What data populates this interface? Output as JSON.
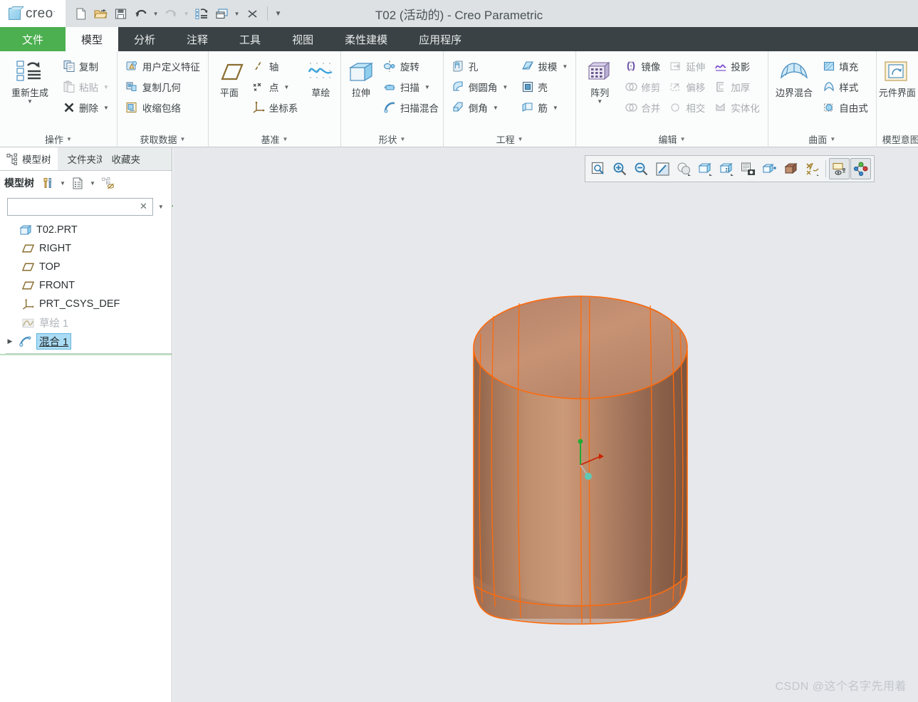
{
  "window": {
    "title": "T02 (活动的) - Creo Parametric",
    "brand": "creo"
  },
  "quick_access": {
    "items": [
      {
        "name": "new-file-button",
        "icon": "new-document-icon",
        "label": "新建"
      },
      {
        "name": "open-file-button",
        "icon": "open-folder-icon",
        "label": "打开"
      },
      {
        "name": "save-button",
        "icon": "floppy-disk-icon",
        "label": "保存"
      },
      {
        "name": "undo-button",
        "icon": "undo-arrow-icon",
        "label": "撤消"
      },
      {
        "name": "redo-button",
        "icon": "redo-arrow-icon",
        "label": "重做"
      },
      {
        "name": "regenerate-button",
        "icon": "regenerate-icon",
        "label": "重新生成"
      },
      {
        "name": "window-button",
        "icon": "windows-icon",
        "label": "窗口"
      },
      {
        "name": "close-window-button",
        "icon": "close-x-icon",
        "label": "关闭"
      },
      {
        "name": "customize-qat-button",
        "icon": "chevron-down-icon",
        "label": "自定义快速访问工具栏"
      }
    ]
  },
  "ribbon": {
    "tabs": [
      {
        "label": "文件",
        "state": "file"
      },
      {
        "label": "模型",
        "state": "active"
      },
      {
        "label": "分析",
        "state": "normal"
      },
      {
        "label": "注释",
        "state": "normal"
      },
      {
        "label": "工具",
        "state": "normal"
      },
      {
        "label": "视图",
        "state": "normal"
      },
      {
        "label": "柔性建模",
        "state": "normal"
      },
      {
        "label": "应用程序",
        "state": "normal"
      }
    ],
    "groups": {
      "operations": {
        "title": "操作",
        "regenerate": "重新生成",
        "copy": "复制",
        "paste": "粘贴",
        "delete": "删除"
      },
      "get_data": {
        "title": "获取数据",
        "user_defined_feature": "用户定义特征",
        "copy_geometry": "复制几何",
        "shrinkwrap": "收缩包络"
      },
      "datum": {
        "title": "基准",
        "plane": "平面",
        "axis": "轴",
        "point": "点",
        "coordinate_system": "坐标系",
        "sketch": "草绘"
      },
      "shapes": {
        "title": "形状",
        "extrude": "拉伸",
        "revolve": "旋转",
        "sweep": "扫描",
        "swept_blend": "扫描混合"
      },
      "engineering": {
        "title": "工程",
        "hole": "孔",
        "round": "倒圆角",
        "chamfer": "倒角",
        "draft": "拔模",
        "shell": "壳",
        "rib": "筋"
      },
      "editing": {
        "title": "编辑",
        "pattern": "阵列",
        "mirror": "镜像",
        "trim": "修剪",
        "merge": "合并",
        "extend": "延伸",
        "offset": "偏移",
        "intersect": "相交",
        "project": "投影",
        "thicken": "加厚",
        "solidify": "实体化"
      },
      "surfaces": {
        "title": "曲面",
        "boundary_blend": "边界混合",
        "fill": "填充",
        "style": "样式",
        "freestyle": "自由式"
      },
      "model_intent": {
        "title": "模型意图",
        "component_interface": "元件界面"
      }
    }
  },
  "navigator": {
    "tabs": [
      {
        "label": "模型树",
        "icon": "model-tree-icon",
        "state": "active"
      },
      {
        "label": "文件夹浏览器",
        "icon": "folder-icon",
        "state": "normal"
      },
      {
        "label": "收藏夹",
        "icon": "favorites-icon",
        "state": "normal"
      }
    ],
    "toolbar": {
      "label": "模型树",
      "settings_icon": "tools-icon",
      "display_icon": "list-document-icon",
      "tree_filters_icon": "tree-hidden-icon"
    },
    "search": {
      "value": "",
      "placeholder": "",
      "filter_icon": "funnel-icon",
      "clear_icon": "clear-x-icon",
      "dropdown_icon": "chevron-down-icon",
      "add_icon": "plus-icon"
    },
    "tree": [
      {
        "label": "T02.PRT",
        "icon": "part-cube-icon",
        "indent": 0,
        "state": "normal",
        "arrow": false
      },
      {
        "label": "RIGHT",
        "icon": "datum-plane-icon",
        "indent": 1,
        "state": "normal",
        "arrow": false
      },
      {
        "label": "TOP",
        "icon": "datum-plane-icon",
        "indent": 1,
        "state": "normal",
        "arrow": false
      },
      {
        "label": "FRONT",
        "icon": "datum-plane-icon",
        "indent": 1,
        "state": "normal",
        "arrow": false
      },
      {
        "label": "PRT_CSYS_DEF",
        "icon": "coordinate-system-icon",
        "indent": 1,
        "state": "normal",
        "arrow": false
      },
      {
        "label": "草绘 1",
        "icon": "sketch-icon",
        "indent": 1,
        "state": "dimmed",
        "arrow": false
      },
      {
        "label": "混合 1",
        "icon": "blend-feature-icon",
        "indent": 1,
        "state": "selected",
        "arrow": true
      }
    ]
  },
  "graphics_toolbar": {
    "buttons": [
      {
        "name": "refit-button",
        "icon": "zoom-fit-icon",
        "label": "重新调整"
      },
      {
        "name": "zoom-in-button",
        "icon": "zoom-in-icon",
        "label": "放大"
      },
      {
        "name": "zoom-out-button",
        "icon": "zoom-out-icon",
        "label": "缩小"
      },
      {
        "name": "repaint-button",
        "icon": "repaint-icon",
        "label": "重画"
      },
      {
        "name": "display-style-button",
        "icon": "shading-sphere-icon",
        "label": "显示样式"
      },
      {
        "name": "saved-orientations-button",
        "icon": "view-cube-icon",
        "label": "已保存方向"
      },
      {
        "name": "view-manager-button",
        "icon": "view-manager-icon",
        "label": "视图管理器"
      },
      {
        "name": "appearance-gallery-button",
        "icon": "appearance-camera-icon",
        "label": "外观库"
      },
      {
        "name": "perspective-view-button",
        "icon": "perspective-cube-icon",
        "label": "透视图"
      },
      {
        "name": "scene-button",
        "icon": "scene-cube-icon",
        "label": "场景"
      },
      {
        "name": "annotation-display-button",
        "icon": "annotation-display-icon",
        "label": "注释显示"
      },
      {
        "name": "datum-display-filters-button",
        "icon": "datum-display-icon",
        "label": "基准显示过滤器",
        "pressed": true
      },
      {
        "name": "spin-center-button",
        "icon": "spin-center-icon",
        "label": "旋转中心"
      }
    ]
  },
  "model": {
    "name": "混合 1",
    "colors": {
      "surface_light": "#c79274",
      "surface_dark": "#8c5f48",
      "edge": "#ff6600",
      "background": "#e6e8ec"
    },
    "csys": {
      "axis_x_color": "#cc2200",
      "axis_y_color": "#22aa33",
      "origin_color": "#5fc9b4"
    }
  },
  "watermark": "CSDN @这个名字先用着"
}
